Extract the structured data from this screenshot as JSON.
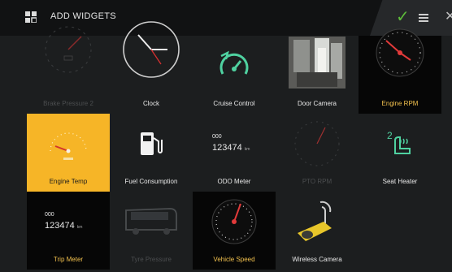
{
  "header": {
    "title": "ADD WIDGETS",
    "icon": "widgets-icon",
    "check_icon": "check-icon",
    "menu_icon": "menu-icon",
    "close_icon": "close-icon"
  },
  "widgets": [
    {
      "label": "Brake Pressure 2",
      "icon": "speedometer-icon",
      "state": "dim"
    },
    {
      "label": "Clock",
      "icon": "clock-icon",
      "state": "normal"
    },
    {
      "label": "Cruise Control",
      "icon": "cruise-control-icon",
      "state": "normal"
    },
    {
      "label": "Door Camera",
      "icon": "door-camera-icon",
      "state": "normal"
    },
    {
      "label": "Engine RPM",
      "icon": "tachometer-icon",
      "state": "black"
    },
    {
      "label": "Engine Temp",
      "icon": "temperature-gauge-icon",
      "state": "selected"
    },
    {
      "label": "Fuel Consumption",
      "icon": "fuel-pump-icon",
      "state": "normal"
    },
    {
      "label": "ODO Meter",
      "icon": "odometer-icon",
      "state": "normal",
      "value_small": "000",
      "value_big": "123474",
      "unit": "km"
    },
    {
      "label": "PTO RPM",
      "icon": "gauge-icon",
      "state": "dim"
    },
    {
      "label": "Seat Heater",
      "icon": "seat-heater-icon",
      "state": "normal",
      "level": "2"
    },
    {
      "label": "Trip Meter",
      "icon": "trip-meter-icon",
      "state": "black",
      "value_small": "000",
      "value_big": "123474",
      "unit": "km"
    },
    {
      "label": "Tyre Pressure",
      "icon": "bus-icon",
      "state": "dim"
    },
    {
      "label": "Vehicle Speed",
      "icon": "speedometer-icon",
      "state": "black"
    },
    {
      "label": "Wireless Camera",
      "icon": "wireless-camera-icon",
      "state": "normal"
    }
  ],
  "colors": {
    "accent": "#f6b527",
    "green": "#4fd1a0",
    "check": "#5dbb3a"
  }
}
